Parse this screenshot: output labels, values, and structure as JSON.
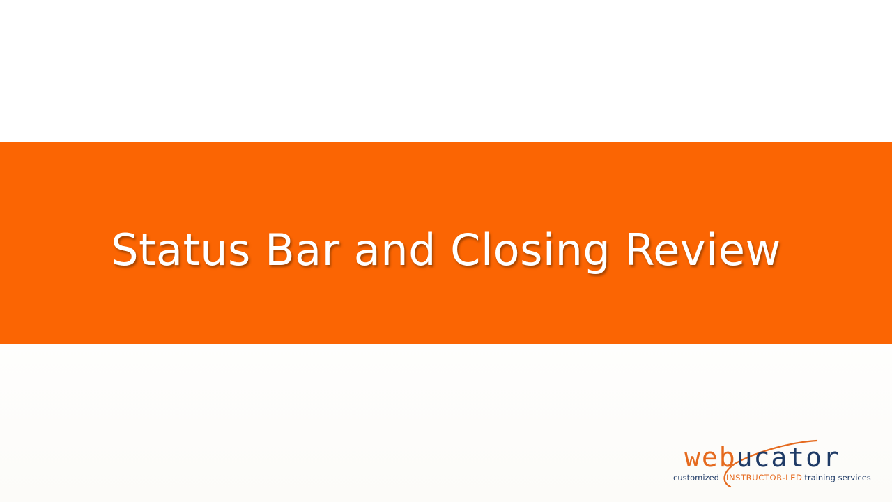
{
  "slide": {
    "title": "Status Bar and Closing Review",
    "band_color": "#fb6503"
  },
  "logo": {
    "word_part1": "web",
    "word_part2": "ucator",
    "tagline_part1": "customized",
    "tagline_part2": "INSTRUCTOR-LED",
    "tagline_part3": "training services",
    "accent_color": "#e56a1e",
    "primary_color": "#1f3b66"
  }
}
